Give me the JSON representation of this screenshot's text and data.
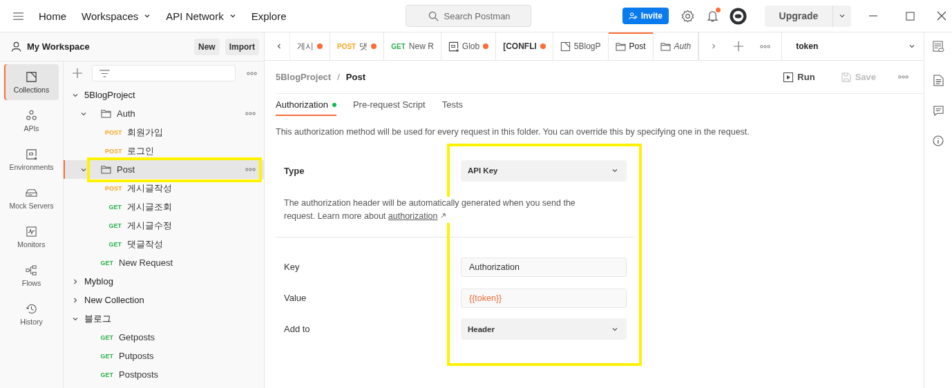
{
  "top_nav": {
    "links": [
      {
        "label": "Home",
        "dropdown": false
      },
      {
        "label": "Workspaces",
        "dropdown": true
      },
      {
        "label": "API Network",
        "dropdown": true
      },
      {
        "label": "Explore",
        "dropdown": false
      }
    ],
    "search": {
      "placeholder": "Search Postman"
    },
    "invite": "Invite",
    "notification": true,
    "upgrade": "Upgrade"
  },
  "workspace": {
    "name": "My Workspace",
    "buttons": [
      "New",
      "Import"
    ]
  },
  "rail": [
    {
      "kind": "collections",
      "label": "Collections",
      "selected": true
    },
    {
      "kind": "apis",
      "label": "APIs",
      "selected": false
    },
    {
      "kind": "environments",
      "label": "Environments",
      "selected": false
    },
    {
      "kind": "mock",
      "label": "Mock Servers",
      "selected": false
    },
    {
      "kind": "monitors",
      "label": "Monitors",
      "selected": false
    },
    {
      "kind": "flows",
      "label": "Flows",
      "selected": false
    },
    {
      "kind": "history",
      "label": "History",
      "selected": false
    }
  ],
  "tree": [
    {
      "kind": "collection",
      "name": "5BlogProject",
      "expanded": true,
      "selected": false,
      "children": [
        {
          "kind": "folder",
          "name": "Auth",
          "expanded": true,
          "selected": false,
          "children": [
            {
              "kind": "request",
              "method": "POST",
              "color": "#f5a623",
              "name": "회원가입",
              "selected": false
            },
            {
              "kind": "request",
              "method": "POST",
              "color": "#f5a623",
              "name": "로그인",
              "selected": false
            }
          ]
        },
        {
          "kind": "folder",
          "name": "Post",
          "expanded": true,
          "selected": true,
          "children": [
            {
              "kind": "request",
              "method": "POST",
              "color": "#f5a623",
              "name": "게시글작성",
              "selected": false
            },
            {
              "kind": "request",
              "method": "GET",
              "color": "#2bb24c",
              "name": "게시글조회",
              "selected": false
            },
            {
              "kind": "request",
              "method": "GET",
              "color": "#2bb24c",
              "name": "게시글수정",
              "selected": false
            },
            {
              "kind": "request",
              "method": "GET",
              "color": "#2bb24c",
              "name": "댓글작성",
              "selected": false
            }
          ]
        },
        {
          "kind": "request",
          "method": "GET",
          "color": "#2bb24c",
          "name": "New Request",
          "selected": false
        }
      ]
    },
    {
      "kind": "collection",
      "name": "Myblog",
      "expanded": false,
      "selected": false
    },
    {
      "kind": "collection",
      "name": "New Collection",
      "expanded": false,
      "selected": false
    },
    {
      "kind": "collection",
      "name": "블로그",
      "expanded": true,
      "selected": false,
      "children": [
        {
          "kind": "request",
          "method": "GET",
          "color": "#2bb24c",
          "name": "Getposts",
          "selected": false
        },
        {
          "kind": "request",
          "method": "GET",
          "color": "#2bb24c",
          "name": "Putposts",
          "selected": false
        },
        {
          "kind": "request",
          "method": "GET",
          "color": "#2bb24c",
          "name": "Postposts",
          "selected": false
        }
      ]
    }
  ],
  "tabs": [
    {
      "kind": "request",
      "label": "게시",
      "dot": true,
      "selected": false,
      "preview": false
    },
    {
      "kind": "request",
      "method": "POST",
      "color": "#f5a623",
      "label": "댓",
      "dot": true,
      "selected": false,
      "preview": false
    },
    {
      "kind": "request",
      "method": "GET",
      "color": "#2bb24c",
      "label": "New R",
      "dot": false,
      "selected": false,
      "preview": false
    },
    {
      "kind": "environment",
      "label": "Glob",
      "dot": true,
      "selected": false,
      "preview": false
    },
    {
      "kind": "conflict",
      "label": "[CONFLI",
      "dot": true,
      "selected": false,
      "preview": false
    },
    {
      "kind": "collection",
      "label": "5BlogP",
      "dot": false,
      "selected": false,
      "preview": false
    },
    {
      "kind": "folder",
      "label": "Post",
      "dot": false,
      "selected": true,
      "preview": false
    },
    {
      "kind": "folder",
      "label": "Auth",
      "dot": false,
      "selected": false,
      "preview": true
    }
  ],
  "environment": "token",
  "breadcrumb": {
    "parent": "5BlogProject",
    "separator": "/",
    "current": "Post"
  },
  "actions": {
    "run": "Run",
    "save": "Save",
    "save_disabled": true
  },
  "sub_tabs": [
    {
      "label": "Authorization",
      "selected": true,
      "dot": true
    },
    {
      "label": "Pre-request Script",
      "selected": false,
      "dot": false
    },
    {
      "label": "Tests",
      "selected": false,
      "dot": false
    }
  ],
  "description": "This authorization method will be used for every request in this folder. You can override this by specifying one in the request.",
  "type": {
    "label": "Type",
    "value": "API Key"
  },
  "help": {
    "text": "The authorization header will be automatically generated when you send the request. Learn more about ",
    "link": "authorization"
  },
  "fields": [
    {
      "kind": "input",
      "label": "Key",
      "value": "Authorization"
    },
    {
      "kind": "variable",
      "label": "Value",
      "value": "{{token}}"
    },
    {
      "kind": "dropdown",
      "label": "Add to",
      "value": "Header"
    }
  ]
}
